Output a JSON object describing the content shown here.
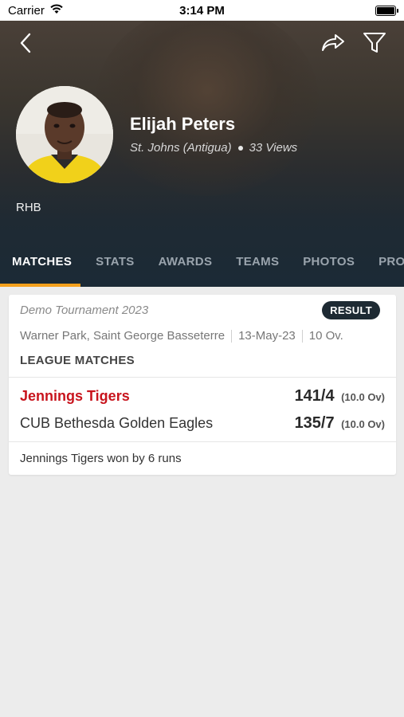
{
  "status_bar": {
    "carrier": "Carrier",
    "time": "3:14 PM"
  },
  "profile": {
    "name": "Elijah Peters",
    "location": "St. Johns (Antigua)",
    "views": "33 Views",
    "role": "RHB"
  },
  "tabs": [
    {
      "label": "MATCHES",
      "active": true
    },
    {
      "label": "STATS",
      "active": false
    },
    {
      "label": "AWARDS",
      "active": false
    },
    {
      "label": "TEAMS",
      "active": false
    },
    {
      "label": "PHOTOS",
      "active": false
    },
    {
      "label": "PROFILE",
      "active": false
    }
  ],
  "match": {
    "tournament": "Demo Tournament 2023",
    "badge": "RESULT",
    "venue": "Warner Park, Saint George Basseterre",
    "date": "13-May-23",
    "overs_format": "10 Ov.",
    "match_type": "LEAGUE MATCHES",
    "team1": {
      "name": "Jennings Tigers",
      "score": "141/4",
      "overs": "(10.0 Ov)"
    },
    "team2": {
      "name": "CUB Bethesda Golden Eagles",
      "score": "135/7",
      "overs": "(10.0 Ov)"
    },
    "result": "Jennings Tigers won by 6 runs"
  },
  "colors": {
    "accent": "#f4a01c",
    "winner": "#c8141d",
    "header_dark": "#1b2a36"
  }
}
